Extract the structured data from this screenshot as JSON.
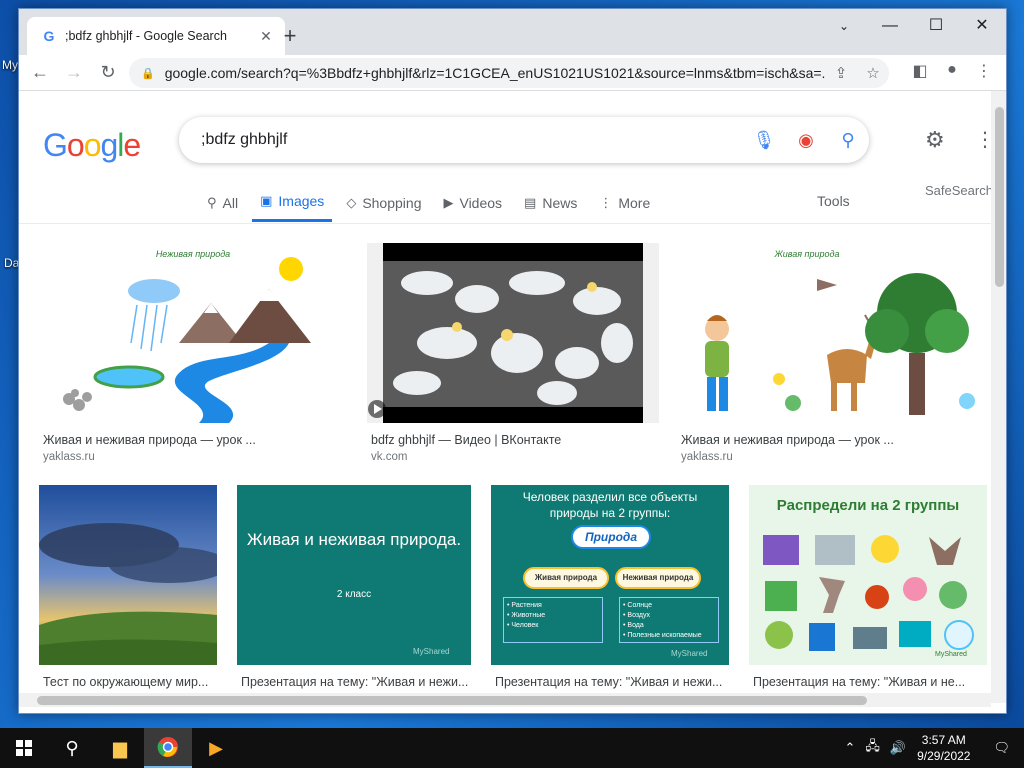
{
  "desktop": {
    "icon_labels": [
      "My",
      "Da"
    ]
  },
  "browser": {
    "tab_title": ";bdfz ghbhjlf - Google Search",
    "url": "google.com/search?q=%3Bbdfz+ghbhjlf&rlz=1C1GCEA_enUS1021US1021&source=lnms&tbm=isch&sa=..."
  },
  "search": {
    "logo": "Google",
    "query": ";bdfz ghbhjlf",
    "tabs": [
      {
        "label": "All",
        "icon": "search-icon"
      },
      {
        "label": "Images",
        "icon": "image-icon"
      },
      {
        "label": "Shopping",
        "icon": "tag-icon"
      },
      {
        "label": "Videos",
        "icon": "play-icon"
      },
      {
        "label": "News",
        "icon": "news-icon"
      },
      {
        "label": "More",
        "icon": "dots-icon"
      }
    ],
    "tools_label": "Tools",
    "safesearch_label": "SafeSearch"
  },
  "results": [
    {
      "caption": "Живая и неживая природа — урок ...",
      "source": "yaklass.ru",
      "thumb_title": "Неживая природа"
    },
    {
      "caption": "bdfz ghbhjlf — Видео | ВКонтакте",
      "source": "vk.com"
    },
    {
      "caption": "Живая и неживая природа — урок ...",
      "source": "yaklass.ru",
      "thumb_title": "Живая природа"
    },
    {
      "caption": "Тест по окружающему мир...",
      "source": ""
    },
    {
      "caption": "Презентация на тему: \"Живая и нежи...",
      "source": "",
      "thumb_title": "Живая и неживая природа.",
      "thumb_sub": "2 класс",
      "watermark": "MyShared"
    },
    {
      "caption": "Презентация на тему: \"Живая и нежи...",
      "source": "",
      "thumb_title": "Человек разделил все объекты природы на 2 группы:",
      "center_label": "Природа",
      "left_label": "Живая природа",
      "right_label": "Неживая природа",
      "left_items": [
        "• Растения",
        "• Животные",
        "• Человек"
      ],
      "right_items": [
        "• Солнце",
        "• Воздух",
        "• Вода",
        "• Полезные ископаемые"
      ],
      "watermark": "MyShared"
    },
    {
      "caption": "Презентация на тему: \"Живая и не...",
      "source": "",
      "thumb_title": "Распредели на 2 группы",
      "watermark": "MyShared"
    }
  ],
  "taskbar": {
    "time": "3:57 AM",
    "date": "9/29/2022"
  },
  "colors": {
    "google_blue": "#4285f4",
    "google_red": "#ea4335",
    "google_yellow": "#fbbc05",
    "google_green": "#34a853",
    "active_tab": "#1a73e8"
  }
}
